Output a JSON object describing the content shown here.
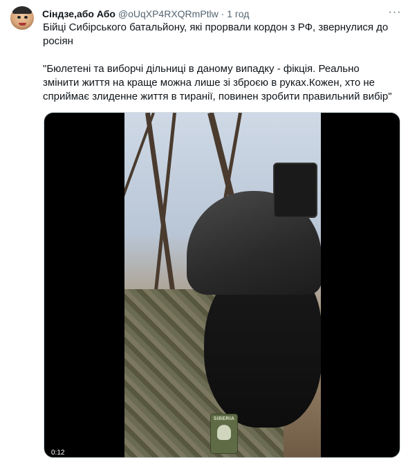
{
  "tweet": {
    "author_name": "Сіндзе,або Або",
    "author_handle": "@oUqXP4RXQRmPtlw",
    "separator": "·",
    "time": "1 год",
    "more_icon": "more-dots-icon",
    "text_line1": "Бійці Сибірського батальйону, які прорвали кордон з РФ, звернулися до",
    "text_line2": "росіян",
    "quote_line1": "\"Бюлетені та виборчі дільниці в даному випадку - фікція. Реально",
    "quote_line2": "змінити життя на краще можна лише зі зброєю в руках.Кожен, хто не",
    "quote_line3": "сприймає злиденне життя в тиранії, повинен зробити правильний вибір\""
  },
  "media": {
    "patch_label": "SIBERIA",
    "duration": "0:12"
  }
}
